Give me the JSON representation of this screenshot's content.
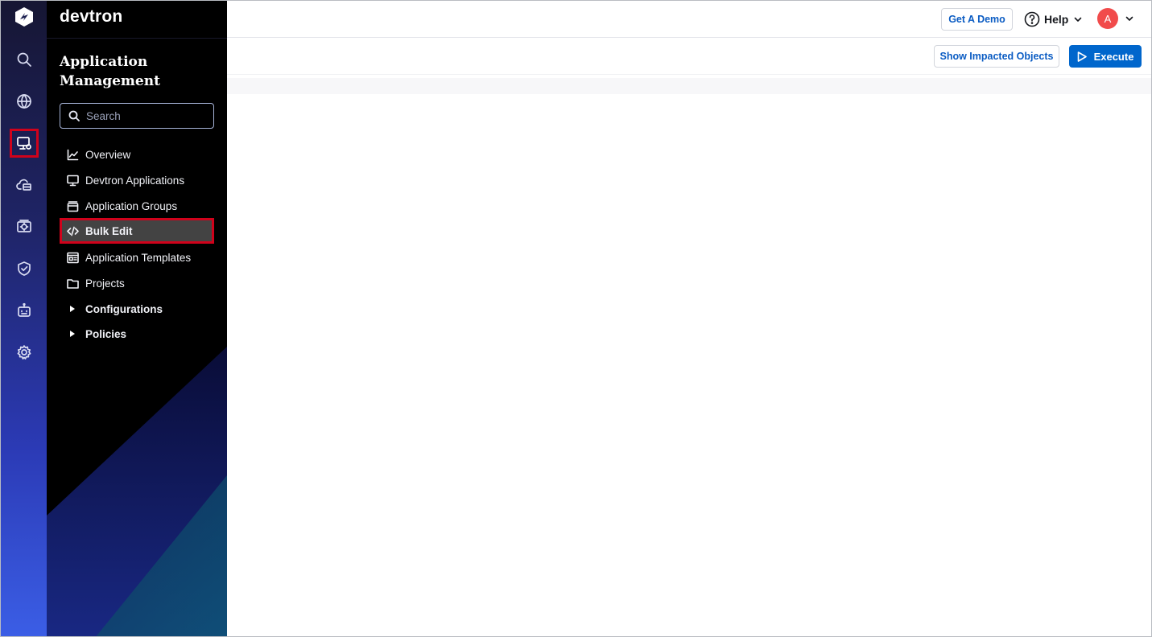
{
  "brand": {
    "name": "devtron"
  },
  "rail": {
    "items": [
      {
        "icon": "search-icon"
      },
      {
        "icon": "globe-icon"
      },
      {
        "icon": "application-management-icon",
        "highlighted": true
      },
      {
        "icon": "cloud-cluster-icon"
      },
      {
        "icon": "security-scan-icon"
      },
      {
        "icon": "shield-check-icon"
      },
      {
        "icon": "robot-icon"
      },
      {
        "icon": "gear-icon"
      }
    ]
  },
  "nav": {
    "title": "Application Management",
    "search_placeholder": "Search",
    "items": [
      {
        "label": "Overview",
        "icon": "chart-line-icon"
      },
      {
        "label": "Devtron Applications",
        "icon": "monitor-icon"
      },
      {
        "label": "Application Groups",
        "icon": "stack-icon"
      },
      {
        "label": "Bulk Edit",
        "icon": "code-icon",
        "active": true
      },
      {
        "label": "Application Templates",
        "icon": "template-icon"
      },
      {
        "label": "Projects",
        "icon": "folder-icon"
      }
    ],
    "groups": [
      {
        "label": "Configurations",
        "icon": "caret-right-icon"
      },
      {
        "label": "Policies",
        "icon": "caret-right-icon"
      }
    ]
  },
  "header": {
    "demo_button": "Get A Demo",
    "help_label": "Help",
    "avatar_initial": "A"
  },
  "actions": {
    "impacted_button": "Show Impacted Objects",
    "execute_button": "Execute"
  },
  "colors": {
    "accent": "#0066cc",
    "highlight_border": "#d0021b",
    "avatar": "#f14b4b"
  }
}
